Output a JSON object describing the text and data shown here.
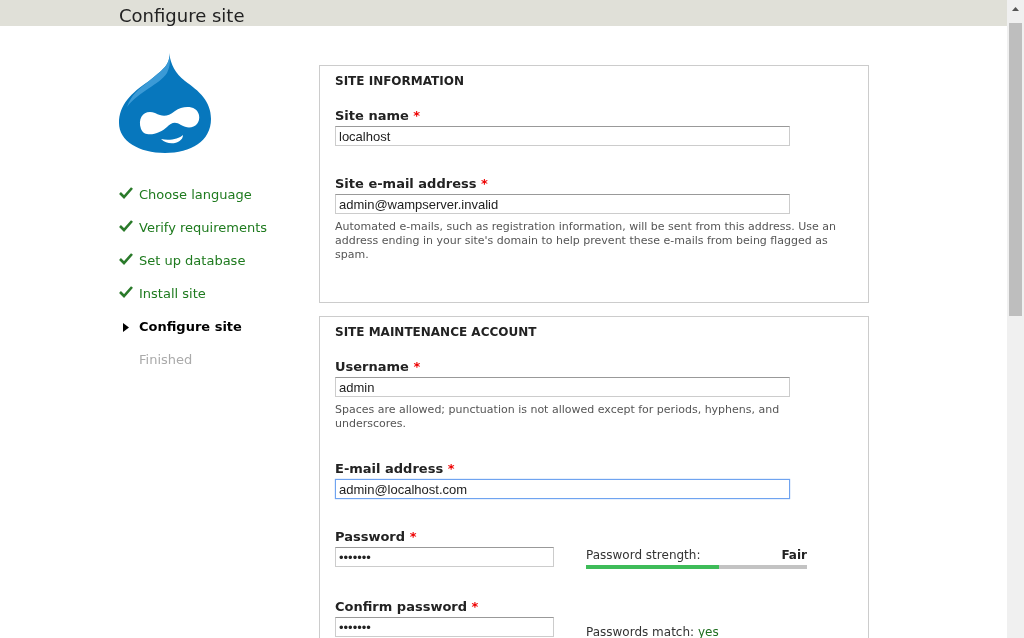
{
  "header": {
    "title": "Configure site"
  },
  "steps": [
    {
      "label": "Choose language",
      "kind": "done"
    },
    {
      "label": "Verify requirements",
      "kind": "done"
    },
    {
      "label": "Set up database",
      "kind": "done"
    },
    {
      "label": "Install site",
      "kind": "done"
    },
    {
      "label": "Configure site",
      "kind": "active"
    },
    {
      "label": "Finished",
      "kind": "pending"
    }
  ],
  "fieldsets": [
    {
      "legend": "SITE INFORMATION",
      "fields": [
        {
          "kind": "text",
          "label": "Site name",
          "required_mark": "*",
          "value": "localhost",
          "focused": false
        },
        {
          "kind": "text",
          "label": "Site e-mail address",
          "required_mark": "*",
          "value": "admin@wampserver.invalid",
          "focused": false,
          "description": "Automated e-mails, such as registration information, will be sent from this address. Use an address ending in your site's domain to help prevent these e-mails from being flagged as spam."
        }
      ]
    },
    {
      "legend": "SITE MAINTENANCE ACCOUNT",
      "fields": [
        {
          "kind": "text",
          "label": "Username",
          "required_mark": "*",
          "value": "admin",
          "focused": false,
          "description": "Spaces are allowed; punctuation is not allowed except for periods, hyphens, and underscores."
        },
        {
          "kind": "text",
          "label": "E-mail address",
          "required_mark": "*",
          "value": "admin@localhost.com",
          "focused": true
        },
        {
          "kind": "password",
          "label": "Password",
          "required_mark": "*",
          "value": "•••••••",
          "focused": false,
          "strength": {
            "label": "Password strength:",
            "value": "Fair",
            "level": 0.6
          }
        },
        {
          "kind": "confirm",
          "label": "Confirm password",
          "required_mark": "*",
          "value": "•••••••",
          "focused": false,
          "match": {
            "label": "Passwords match:",
            "value": "yes"
          }
        }
      ]
    }
  ]
}
